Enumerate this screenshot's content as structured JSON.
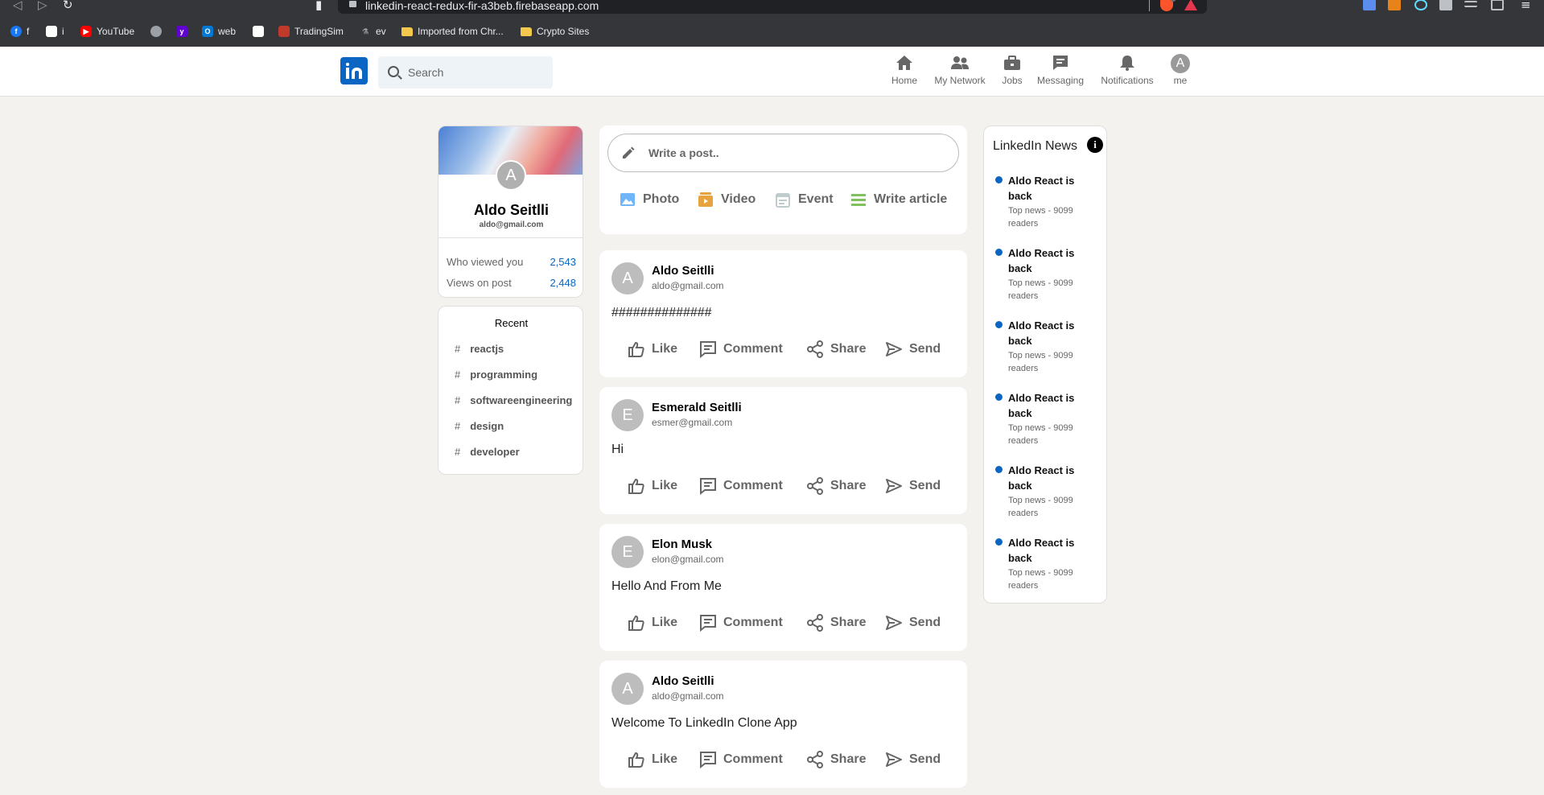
{
  "browser": {
    "url": "linkedin-react-redux-fir-a3beb.firebaseapp.com",
    "brave_badge": "4",
    "bookmarks": [
      {
        "label": "f",
        "icon": "facebook-icon",
        "color": "#1877f2"
      },
      {
        "label": "i",
        "icon": "page-icon",
        "color": "#ffffff"
      },
      {
        "label": "YouTube",
        "icon": "youtube-icon",
        "color": "#ff0000"
      },
      {
        "label": "",
        "icon": "globe-icon",
        "color": "#9aa0a6"
      },
      {
        "label": "",
        "icon": "yahoo-icon",
        "color": "#6001d2"
      },
      {
        "label": "web",
        "icon": "outlook-icon",
        "color": "#0078d4"
      },
      {
        "label": "",
        "icon": "page-icon",
        "color": "#ffffff"
      },
      {
        "label": "TradingSim",
        "icon": "tradingsim-icon",
        "color": "#c0392b"
      },
      {
        "label": "ev",
        "icon": "flask-icon",
        "color": "#9aa0a6"
      },
      {
        "label": "Imported from Chr...",
        "icon": "folder-icon",
        "color": "#f2c94c"
      },
      {
        "label": "Crypto Sites",
        "icon": "folder-icon",
        "color": "#f2c94c"
      }
    ]
  },
  "header": {
    "search_placeholder": "Search",
    "nav": [
      {
        "label": "Home",
        "icon": "home-icon"
      },
      {
        "label": "My Network",
        "icon": "network-icon"
      },
      {
        "label": "Jobs",
        "icon": "briefcase-icon"
      },
      {
        "label": "Messaging",
        "icon": "chat-icon"
      },
      {
        "label": "Notifications",
        "icon": "bell-icon"
      },
      {
        "label": "me",
        "icon": "avatar",
        "avatar_letter": "A"
      }
    ]
  },
  "sidebar": {
    "avatar_letter": "A",
    "name": "Aldo Seitlli",
    "email": "aldo@gmail.com",
    "stats": [
      {
        "label": "Who viewed you",
        "value": "2,543"
      },
      {
        "label": "Views on post",
        "value": "2,448"
      }
    ],
    "recent_title": "Recent",
    "recent": [
      "reactjs",
      "programming",
      "softwareengineering",
      "design",
      "developer"
    ]
  },
  "composer": {
    "placeholder": "Write a post..",
    "options": [
      {
        "label": "Photo",
        "icon": "image-icon",
        "color": "#70b5f9"
      },
      {
        "label": "Video",
        "icon": "video-icon",
        "color": "#e7a33e"
      },
      {
        "label": "Event",
        "icon": "calendar-icon",
        "color": "#c0cbcd"
      },
      {
        "label": "Write article",
        "icon": "article-icon",
        "color": "#7fc15e"
      }
    ]
  },
  "post_actions": [
    "Like",
    "Comment",
    "Share",
    "Send"
  ],
  "posts": [
    {
      "avatar": "A",
      "name": "Aldo Seitlli",
      "email": "aldo@gmail.com",
      "body": "##############"
    },
    {
      "avatar": "E",
      "name": "Esmerald Seitlli",
      "email": "esmer@gmail.com",
      "body": "Hi"
    },
    {
      "avatar": "E",
      "name": "Elon Musk",
      "email": "elon@gmail.com",
      "body": "Hello And From Me"
    },
    {
      "avatar": "A",
      "name": "Aldo Seitlli",
      "email": "aldo@gmail.com",
      "body": "Welcome To LinkedIn Clone App"
    }
  ],
  "news": {
    "title": "LinkedIn News",
    "items": [
      {
        "heading": "Aldo React is back",
        "sub": "Top news - 9099 readers"
      },
      {
        "heading": "Aldo React is back",
        "sub": "Top news - 9099 readers"
      },
      {
        "heading": "Aldo React is back",
        "sub": "Top news - 9099 readers"
      },
      {
        "heading": "Aldo React is back",
        "sub": "Top news - 9099 readers"
      },
      {
        "heading": "Aldo React is back",
        "sub": "Top news - 9099 readers"
      },
      {
        "heading": "Aldo React is back",
        "sub": "Top news - 9099 readers"
      }
    ]
  }
}
